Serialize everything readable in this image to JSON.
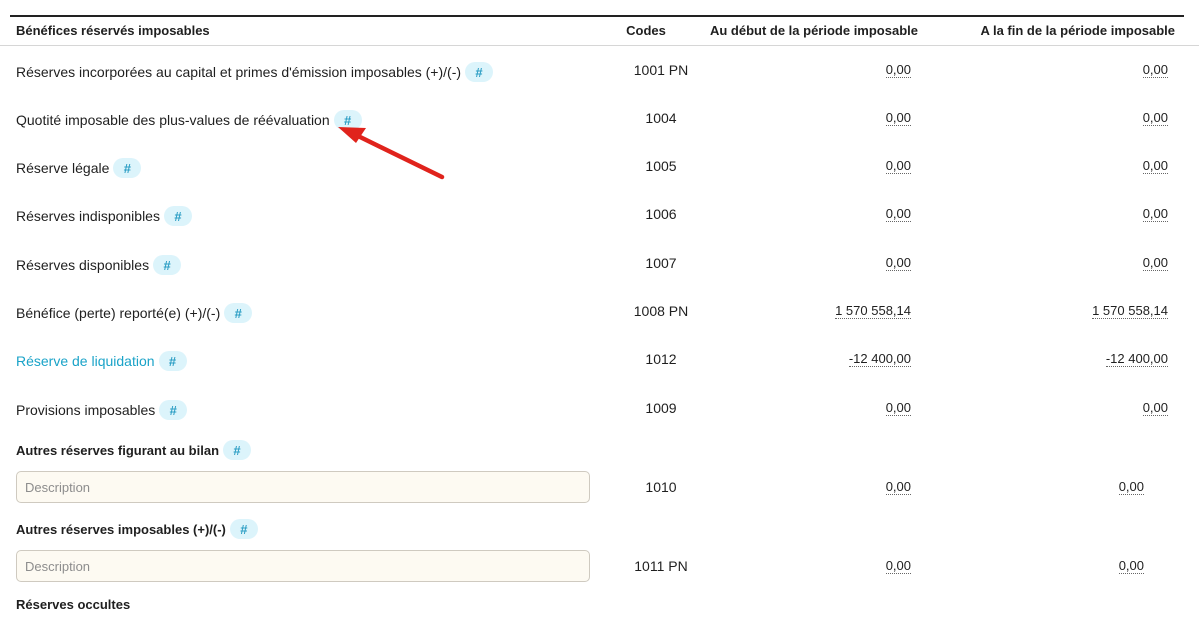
{
  "header": {
    "label": "Bénéfices réservés imposables",
    "codes": "Codes",
    "debut": "Au début de la période imposable",
    "fin": "A la fin de la période imposable"
  },
  "hash_symbol": "#",
  "rows": [
    {
      "label": "Réserves incorporées au capital et primes d'émission imposables (+)/(-)",
      "code": "1001 PN",
      "debut": "0,00",
      "fin": "0,00"
    },
    {
      "label": "Quotité imposable des plus-values de réévaluation",
      "code": "1004",
      "debut": "0,00",
      "fin": "0,00"
    },
    {
      "label": "Réserve légale",
      "code": "1005",
      "debut": "0,00",
      "fin": "0,00"
    },
    {
      "label": "Réserves indisponibles",
      "code": "1006",
      "debut": "0,00",
      "fin": "0,00"
    },
    {
      "label": "Réserves disponibles",
      "code": "1007",
      "debut": "0,00",
      "fin": "0,00"
    },
    {
      "label": "Bénéfice (perte) reporté(e) (+)/(-)",
      "code": "1008 PN",
      "debut": "1 570 558,14",
      "fin": "1 570 558,14"
    },
    {
      "label": "Réserve de liquidation",
      "code": "1012",
      "debut": "-12 400,00",
      "fin": "-12 400,00"
    },
    {
      "label": "Provisions imposables",
      "code": "1009",
      "debut": "0,00",
      "fin": "0,00"
    }
  ],
  "autres_bilan": {
    "label": "Autres réserves figurant au bilan",
    "placeholder": "Description",
    "code": "1010",
    "debut": "0,00",
    "fin": "0,00"
  },
  "autres_imposables": {
    "label": "Autres réserves imposables (+)/(-)",
    "placeholder": "Description",
    "code": "1011 PN",
    "debut": "0,00",
    "fin": "0,00"
  },
  "occultes": {
    "label": "Réserves occultes"
  },
  "colors": {
    "link": "#1aa3c8",
    "hash_bg": "#dcf4fb",
    "arrow": "#e0231c"
  }
}
